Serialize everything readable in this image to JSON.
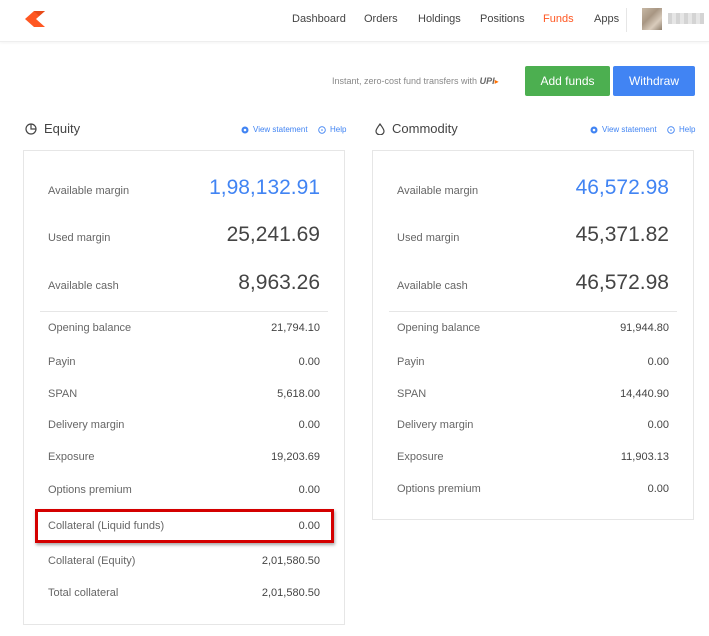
{
  "header": {
    "nav": [
      "Dashboard",
      "Orders",
      "Holdings",
      "Positions",
      "Funds",
      "Apps"
    ],
    "active": "Funds",
    "accent_color": "#ff5722"
  },
  "transfer": {
    "note": "Instant, zero-cost fund transfers with",
    "upi": "UPI",
    "add_funds": "Add funds",
    "withdraw": "Withdraw",
    "add_color": "#4caf50",
    "withdraw_color": "#4184f3"
  },
  "equity": {
    "title": "Equity",
    "view_statement": "View statement",
    "help": "Help",
    "available_margin": {
      "label": "Available margin",
      "value": "1,98,132.91"
    },
    "used_margin": {
      "label": "Used margin",
      "value": "25,241.69"
    },
    "available_cash": {
      "label": "Available cash",
      "value": "8,963.26"
    },
    "rows": [
      {
        "label": "Opening balance",
        "value": "21,794.10"
      },
      {
        "label": "Payin",
        "value": "0.00"
      },
      {
        "label": "SPAN",
        "value": "5,618.00"
      },
      {
        "label": "Delivery margin",
        "value": "0.00"
      },
      {
        "label": "Exposure",
        "value": "19,203.69"
      },
      {
        "label": "Options premium",
        "value": "0.00"
      },
      {
        "label": "Collateral (Liquid funds)",
        "value": "0.00"
      },
      {
        "label": "Collateral (Equity)",
        "value": "2,01,580.50"
      },
      {
        "label": "Total collateral",
        "value": "2,01,580.50"
      }
    ]
  },
  "commodity": {
    "title": "Commodity",
    "view_statement": "View statement",
    "help": "Help",
    "available_margin": {
      "label": "Available margin",
      "value": "46,572.98"
    },
    "used_margin": {
      "label": "Used margin",
      "value": "45,371.82"
    },
    "available_cash": {
      "label": "Available cash",
      "value": "46,572.98"
    },
    "rows": [
      {
        "label": "Opening balance",
        "value": "91,944.80"
      },
      {
        "label": "Payin",
        "value": "0.00"
      },
      {
        "label": "SPAN",
        "value": "14,440.90"
      },
      {
        "label": "Delivery margin",
        "value": "0.00"
      },
      {
        "label": "Exposure",
        "value": "11,903.13"
      },
      {
        "label": "Options premium",
        "value": "0.00"
      }
    ]
  },
  "annotation": {
    "highlight_color": "#d40000"
  }
}
